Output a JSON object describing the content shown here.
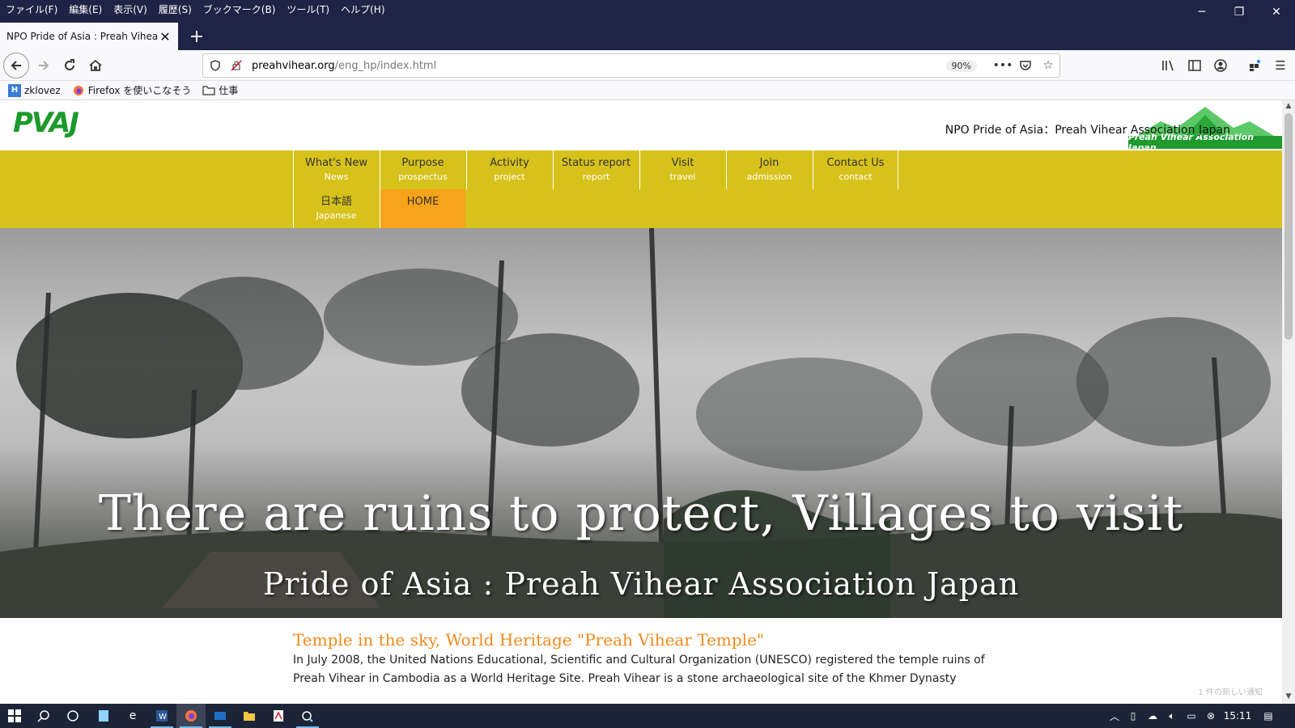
{
  "menubar": {
    "items": [
      "ファイル(F)",
      "編集(E)",
      "表示(V)",
      "履歴(S)",
      "ブックマーク(B)",
      "ツール(T)",
      "ヘルプ(H)"
    ]
  },
  "window_controls": {
    "minimize": "─",
    "restore": "❐",
    "close": "✕"
  },
  "tab": {
    "title": "NPO Pride of Asia : Preah Vihear As",
    "close": "✕",
    "new_tab": "+"
  },
  "navbar": {
    "url_host": "preahvihear.org",
    "url_path": "/eng_hp/index.html",
    "zoom": "90%"
  },
  "bookmarks": [
    {
      "label": "zklovez",
      "icon": "H"
    },
    {
      "label": "Firefox を使いこなそう",
      "icon": "firefox-icon"
    },
    {
      "label": "仕事",
      "icon": "folder-icon"
    }
  ],
  "site": {
    "logo": "PVAJ",
    "tagline": "NPO Pride of Asia：Preah Vihear Association Japan",
    "emblem_text": "Preah Vihear Association Japan",
    "nav": [
      {
        "main": "What's New",
        "sub": "News"
      },
      {
        "main": "Purpose",
        "sub": "prospectus"
      },
      {
        "main": "Activity",
        "sub": "project"
      },
      {
        "main": "Status report",
        "sub": "report"
      },
      {
        "main": "Visit",
        "sub": "travel"
      },
      {
        "main": "Join",
        "sub": "admission"
      },
      {
        "main": "Contact Us",
        "sub": "contact"
      },
      {
        "main": "日本語",
        "sub": "Japanese"
      },
      {
        "main": "HOME",
        "sub": ""
      }
    ],
    "hero_title": "There are ruins to protect, Villages to visit",
    "hero_subtitle": "Pride of Asia : Preah Vihear Association Japan",
    "section_title": "Temple in the sky, World Heritage \"Preah Vihear Temple\"",
    "section_body_1": "In July 2008, the United Nations Educational, Scientific and Cultural Organization (UNESCO) registered the temple ruins of",
    "section_body_2": "Preah Vihear in Cambodia as a World Heritage Site. Preah Vihear is a stone archaeological site of the Khmer Dynasty",
    "notice": "1 件の新しい通知"
  },
  "taskbar": {
    "clock": "15:11"
  },
  "colors": {
    "nav_bg": "#d7c21c",
    "nav_active": "#f7a31b",
    "heading": "#f08a1c",
    "logo_green": "#1c9a2c",
    "chrome_dark": "#1f2345"
  }
}
